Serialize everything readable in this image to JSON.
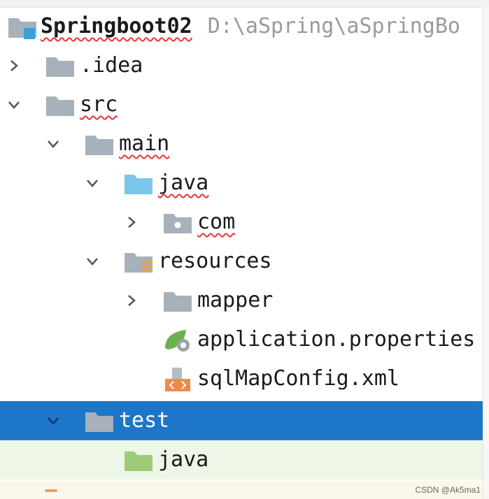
{
  "project": {
    "name": "Springboot02",
    "path": "D:\\aSpring\\aSpringBo"
  },
  "tree": {
    "idea": ".idea",
    "src": "src",
    "main": "main",
    "java_main": "java",
    "com": "com",
    "resources": "resources",
    "mapper": "mapper",
    "app_props": "application.properties",
    "sqlmap": "sqlMapConfig.xml",
    "test": "test",
    "java_test": "java"
  },
  "watermark": "CSDN @Ak5ma1",
  "colors": {
    "selection": "#1e76c8",
    "folder": "#a7b1bb",
    "source_folder": "#7cc6ea",
    "test_folder": "#9ccc7a",
    "resources_badge": "#e8a04a",
    "xml_badge": "#f08a4b",
    "spring_leaf": "#6bb24d",
    "project_badge": "#3aa0d8"
  },
  "icons": {
    "project": "module-folder-icon",
    "folder": "folder-icon",
    "source": "source-root-folder-icon",
    "package": "package-icon",
    "resources": "resources-root-folder-icon",
    "spring": "spring-properties-icon",
    "xml": "xml-file-icon",
    "test": "test-root-folder-icon"
  }
}
